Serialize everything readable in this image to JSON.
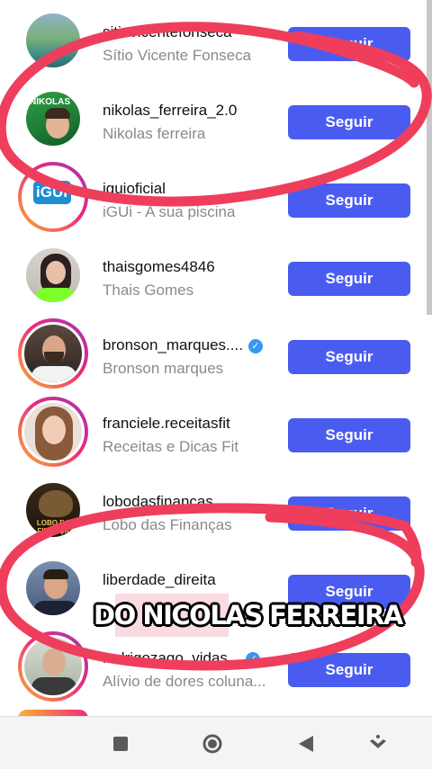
{
  "follow_label": "Seguir",
  "accent_color": "#4a5cf0",
  "suggestions": [
    {
      "username": "sitiovicentefonseca",
      "name": "Sítio Vicente Fonseca",
      "verified": false
    },
    {
      "username": "nikolas_ferreira_2.0",
      "name": "Nikolas ferreira",
      "verified": false
    },
    {
      "username": "iguioficial",
      "name": "iGUi - A sua piscina",
      "verified": false
    },
    {
      "username": "thaisgomes4846",
      "name": "Thais Gomes",
      "verified": false
    },
    {
      "username": "bronson_marques....",
      "name": "Bronson marques",
      "verified": true
    },
    {
      "username": "franciele.receitasfit",
      "name": "Receitas e Dicas Fit",
      "verified": false
    },
    {
      "username": "lobodasfinancas",
      "name": "Lobo das Finanças",
      "verified": false
    },
    {
      "username": "liberdade_direita",
      "name": "",
      "verified": false
    },
    {
      "username": "rodrigozago_vidas...",
      "name": "Alívio de dores coluna...",
      "verified": true
    }
  ],
  "avatar_labels": {
    "nikolas": "NIKOLAS",
    "igui": "iGUi",
    "lobo": "LOBO DAS FINANÇAS"
  },
  "caption": "DO NICOLAS FERREIRA",
  "navigation": {
    "recents_icon": "square-icon",
    "home_icon": "circle-icon",
    "back_icon": "triangle-back-icon",
    "menu_icon": "down-chevron-icon"
  }
}
